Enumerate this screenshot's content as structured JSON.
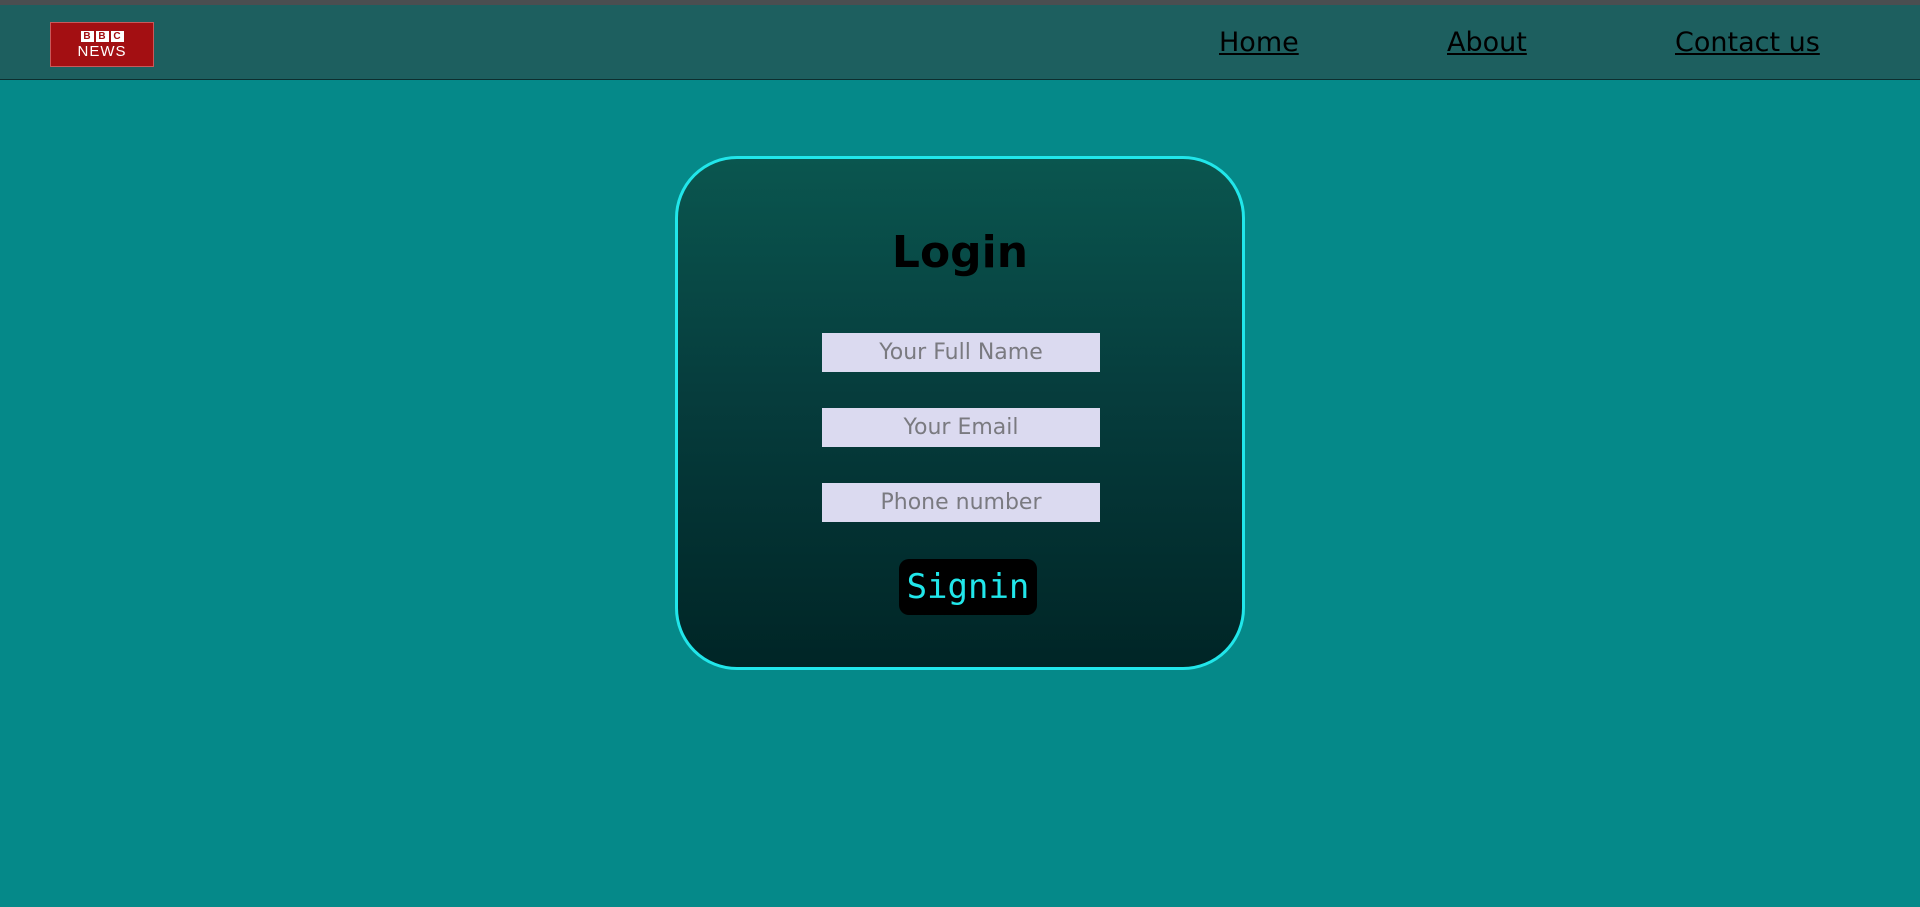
{
  "header": {
    "logo": {
      "top_letters": [
        "B",
        "B",
        "C"
      ],
      "bottom_text": "NEWS",
      "color": "#a30f12"
    },
    "nav": {
      "home": "Home",
      "about": "About",
      "contact": "Contact us"
    }
  },
  "login": {
    "title": "Login",
    "full_name_placeholder": "Your Full Name",
    "email_placeholder": "Your Email",
    "phone_placeholder": "Phone number",
    "signin_label": "Signin"
  },
  "colors": {
    "page_background": "#058989",
    "navbar": "#1d5f5f",
    "card_border": "#21e6ea",
    "input_background": "#dbdaf0",
    "button_background": "#000000",
    "button_text": "#21e6ea"
  }
}
